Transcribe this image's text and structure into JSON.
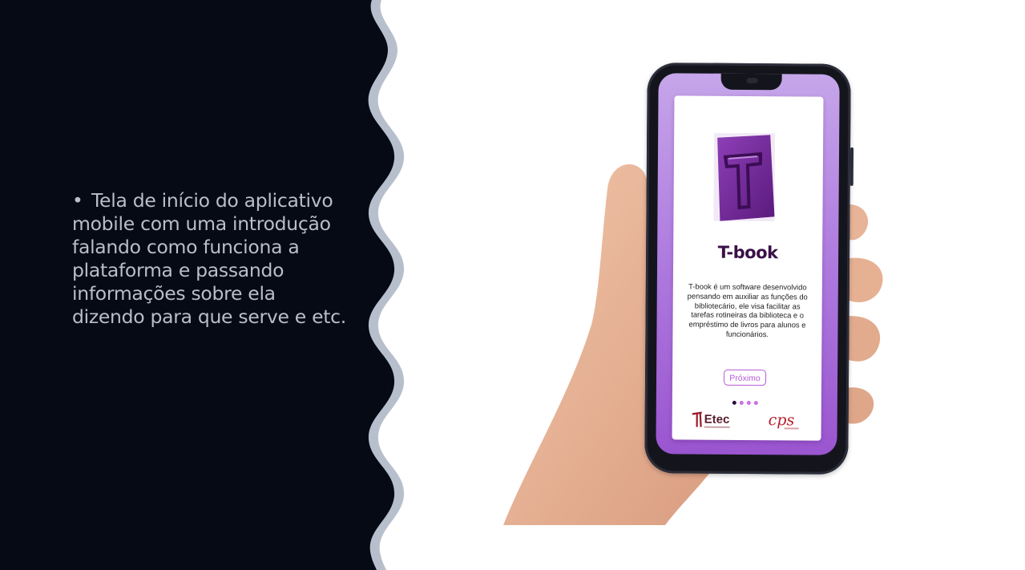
{
  "slide": {
    "bullet_symbol": "•",
    "bullet_text": "Tela de início do aplicativo mobile com uma introdução falando como funciona a plataforma e passando informações sobre ela dizendo para que serve e etc."
  },
  "app": {
    "title": "T-book",
    "description": "T-book é um software desenvolvido pensando em auxiliar as funções do bibliotecário, ele visa facilitar as tarefas rotineiras da biblioteca e o empréstimo de livros para alunos e funcionários.",
    "next_button_label": "Próximo",
    "pager": {
      "pages": 4,
      "current": 1
    },
    "etec_logo_text": "Etec",
    "cps_logo_text": "cps"
  },
  "colors": {
    "left_panel": "#050a14",
    "wave_border": "#b7bfcd",
    "bullet_text": "#b9bec8",
    "accent_purple": "#b85bd8",
    "title_color": "#3a1047"
  }
}
